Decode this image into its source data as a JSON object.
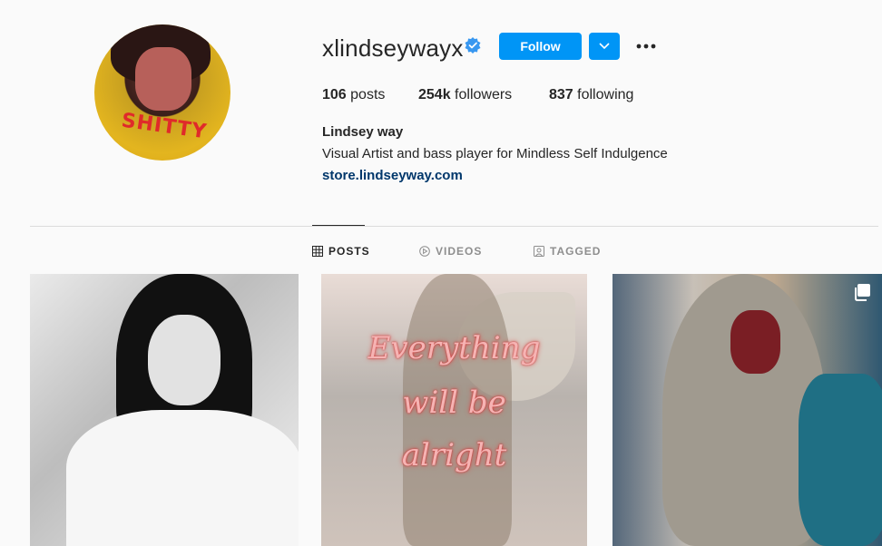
{
  "profile": {
    "username": "xlindseywayx",
    "follow_label": "Follow",
    "avatar_shirt_text": "SHITTY",
    "stats": {
      "posts_count": "106",
      "posts_label": "posts",
      "followers_count": "254k",
      "followers_label": "followers",
      "following_count": "837",
      "following_label": "following"
    },
    "full_name": "Lindsey way",
    "bio": "Visual Artist and bass player for Mindless Self Indulgence",
    "link": "store.lindseyway.com"
  },
  "tabs": [
    {
      "label": "POSTS",
      "icon": "grid-icon",
      "active": true
    },
    {
      "label": "VIDEOS",
      "icon": "play-icon",
      "active": false
    },
    {
      "label": "TAGGED",
      "icon": "tag-icon",
      "active": false
    }
  ],
  "posts": [
    {
      "description_icon": "none"
    },
    {
      "neon_lines": [
        "Everything",
        "will be",
        "alright"
      ]
    },
    {
      "description_icon": "multiple-posts-icon"
    }
  ],
  "colors": {
    "accent": "#0095f6",
    "link": "#00376b",
    "verified": "#3897f0",
    "text": "#262626",
    "muted": "#8e8e8e"
  }
}
